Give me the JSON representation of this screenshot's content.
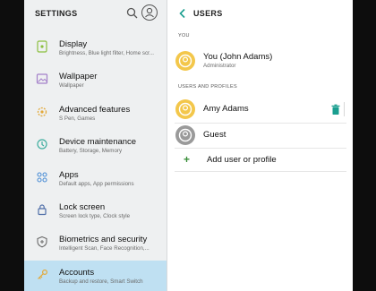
{
  "left_panel": {
    "title": "SETTINGS",
    "items": [
      {
        "title": "Display",
        "subtitle": "Brightness, Blue light filter, Home scr...",
        "icon": "display-icon"
      },
      {
        "title": "Wallpaper",
        "subtitle": "Wallpaper",
        "icon": "wallpaper-icon"
      },
      {
        "title": "Advanced features",
        "subtitle": "S Pen, Games",
        "icon": "advanced-features-icon"
      },
      {
        "title": "Device maintenance",
        "subtitle": "Battery, Storage, Memory",
        "icon": "device-maintenance-icon"
      },
      {
        "title": "Apps",
        "subtitle": "Default apps, App permissions",
        "icon": "apps-icon"
      },
      {
        "title": "Lock screen",
        "subtitle": "Screen lock type, Clock style",
        "icon": "lock-icon"
      },
      {
        "title": "Biometrics and security",
        "subtitle": "Intelligent Scan, Face Recognition,...",
        "icon": "shield-icon"
      },
      {
        "title": "Accounts",
        "subtitle": "Backup and restore, Smart Switch",
        "icon": "key-icon",
        "selected": true
      }
    ]
  },
  "right_panel": {
    "title": "USERS",
    "you_section_label": "YOU",
    "you": {
      "name": "You (John Adams)",
      "role": "Administrator"
    },
    "users_section_label": "USERS AND PROFILES",
    "users": [
      {
        "name": "Amy Adams",
        "avatar": "yellow"
      },
      {
        "name": "Guest",
        "avatar": "gray"
      }
    ],
    "add_label": "Add user or profile"
  },
  "colors": {
    "selected_bg": "#bfe0f2",
    "accent_teal": "#1a9e8f",
    "avatar_yellow": "#f3c74b"
  }
}
